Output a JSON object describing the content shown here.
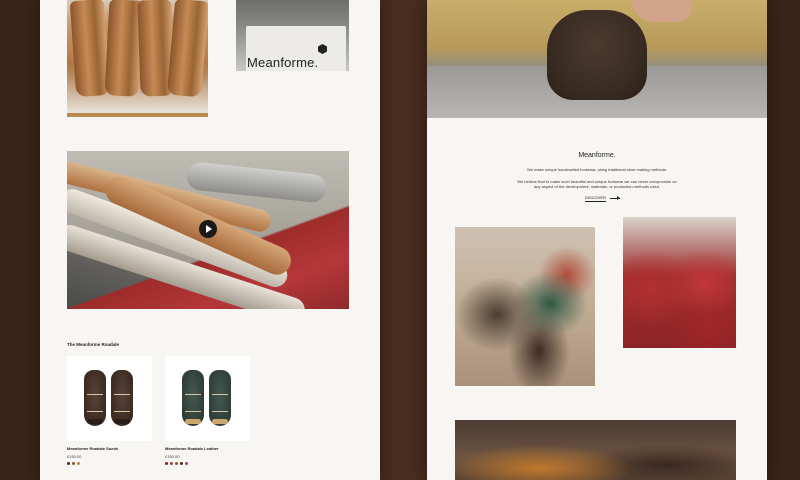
{
  "brand": {
    "wordmark": "Meanforme."
  },
  "collection": {
    "title": "The Meanforme Roadale",
    "products": [
      {
        "name": "Meanforme Roadale Suede",
        "price": "£150.00",
        "swatches": [
          "#3b2b22",
          "#8a5a2e",
          "#b88a4e"
        ]
      },
      {
        "name": "Meanforme Roadale Leather",
        "price": "£150.00",
        "swatches": [
          "#7a1f22",
          "#b23a35",
          "#8a5a2e",
          "#3b2b22",
          "#a04b5a"
        ]
      }
    ]
  },
  "about": {
    "title": "Meanforme.",
    "line1": "We make unique handcrafted footwear, using traditional shoe making methods.",
    "line2": "We believe that to make such beautiful and unique footwear we can never compromise on",
    "line3": "any aspect of the development, materials, or production methods used.",
    "discover_label": "DISCOVER"
  },
  "colors": {
    "page_background": "#f8f6f2",
    "backdrop": "#3a2418",
    "text": "#222222"
  },
  "icons": {
    "play": "play-icon",
    "arrow": "arrow-right-icon",
    "logo": "hexagon-logo-icon"
  }
}
